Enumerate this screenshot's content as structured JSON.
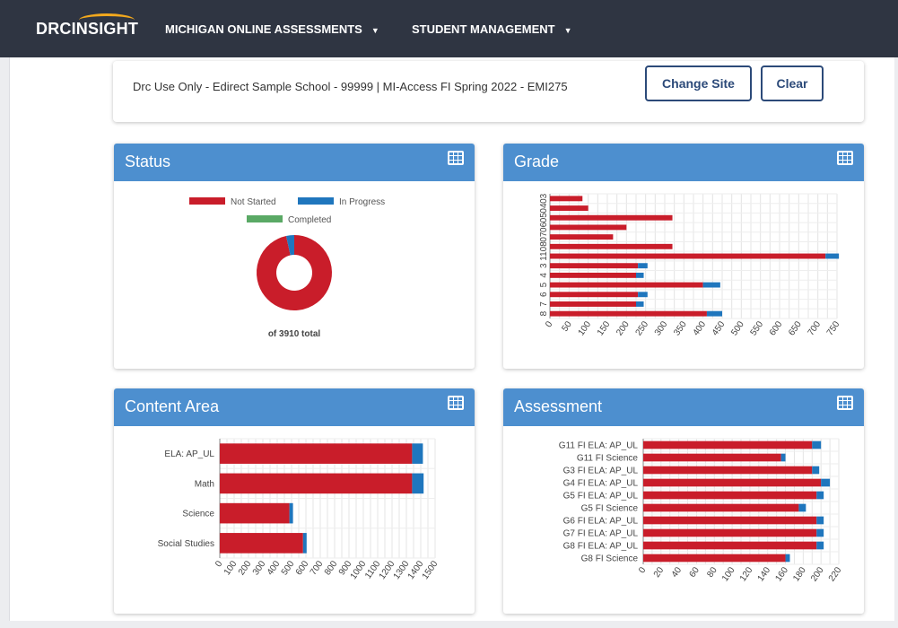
{
  "navbar": {
    "brand_part1": "DRC",
    "brand_part2": "INSIGHT",
    "menu1": "MICHIGAN ONLINE ASSESSMENTS",
    "menu2": "STUDENT MANAGEMENT"
  },
  "site_bar": {
    "text": "Drc Use Only - Edirect Sample School - 99999 | MI-Access FI Spring 2022 - EMI275",
    "change_site_label": "Change Site",
    "clear_label": "Clear"
  },
  "colors": {
    "not_started": "#c91d2a",
    "in_progress": "#1f76bd",
    "completed": "#5aa965",
    "header": "#4d8fcf",
    "navbar": "#2f3542"
  },
  "cards": {
    "status": {
      "title": "Status",
      "icon": "table-grid-icon"
    },
    "grade": {
      "title": "Grade",
      "icon": "table-grid-icon"
    },
    "content": {
      "title": "Content Area",
      "icon": "table-grid-icon"
    },
    "assessment": {
      "title": "Assessment",
      "icon": "table-grid-icon"
    }
  },
  "chart_data": [
    {
      "id": "status",
      "type": "pie",
      "legend": [
        "Not Started",
        "In Progress",
        "Completed"
      ],
      "slices": [
        {
          "name": "Not Started",
          "value": 3775
        },
        {
          "name": "In Progress",
          "value": 135
        },
        {
          "name": "Completed",
          "value": 0
        }
      ],
      "center_label": "of 3910 total"
    },
    {
      "id": "grade",
      "type": "bar",
      "orientation": "horizontal",
      "stacked": true,
      "categories": [
        "03",
        "04",
        "05",
        "06",
        "07",
        "08",
        "11",
        "3",
        "4",
        "5",
        "6",
        "7",
        "8"
      ],
      "series": [
        {
          "name": "Not Started",
          "values": [
            85,
            100,
            320,
            200,
            165,
            320,
            720,
            230,
            225,
            400,
            230,
            225,
            410
          ]
        },
        {
          "name": "In Progress",
          "values": [
            0,
            0,
            0,
            0,
            0,
            0,
            35,
            25,
            20,
            45,
            25,
            20,
            40
          ]
        }
      ],
      "xlim": [
        0,
        750
      ],
      "xticks": [
        "0",
        "50",
        "100",
        "150",
        "200",
        "250",
        "300",
        "350",
        "400",
        "450",
        "500",
        "550",
        "600",
        "650",
        "700",
        "750"
      ]
    },
    {
      "id": "content",
      "type": "bar",
      "orientation": "horizontal",
      "stacked": true,
      "categories": [
        "ELA: AP_UL",
        "Math",
        "Science",
        "Social Studies"
      ],
      "series": [
        {
          "name": "Not Started",
          "values": [
            1340,
            1340,
            485,
            580
          ]
        },
        {
          "name": "In Progress",
          "values": [
            75,
            80,
            25,
            25
          ]
        }
      ],
      "xlim": [
        0,
        1500
      ],
      "xticks": [
        "0",
        "100",
        "200",
        "300",
        "400",
        "500",
        "600",
        "700",
        "800",
        "900",
        "1000",
        "1100",
        "1200",
        "1300",
        "1400",
        "1500"
      ]
    },
    {
      "id": "assessment",
      "type": "bar",
      "orientation": "horizontal",
      "stacked": true,
      "categories": [
        "G11 FI ELA: AP_UL",
        "G11 FI Science",
        "G3 FI ELA: AP_UL",
        "G4 FI ELA: AP_UL",
        "G5 FI ELA: AP_UL",
        "G5 FI Science",
        "G6 FI ELA: AP_UL",
        "G7 FI ELA: AP_UL",
        "G8 FI ELA: AP_UL",
        "G8 FI Science"
      ],
      "series": [
        {
          "name": "Not Started",
          "values": [
            190,
            155,
            190,
            200,
            195,
            175,
            195,
            195,
            195,
            160
          ]
        },
        {
          "name": "In Progress",
          "values": [
            10,
            5,
            8,
            10,
            8,
            8,
            8,
            8,
            8,
            5
          ]
        }
      ],
      "xlim": [
        0,
        220
      ],
      "xticks": [
        "0",
        "20",
        "40",
        "60",
        "80",
        "100",
        "120",
        "140",
        "160",
        "180",
        "200",
        "220"
      ]
    }
  ]
}
